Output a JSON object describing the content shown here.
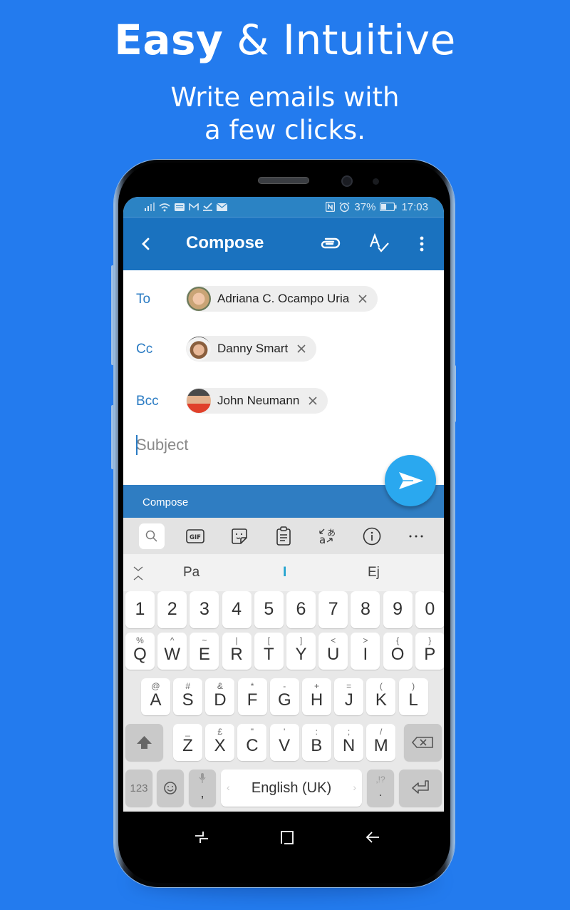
{
  "promo": {
    "headline_bold": "Easy",
    "headline_rest": " & Intuitive",
    "subhead_line1": "Write emails with",
    "subhead_line2": "a few clicks."
  },
  "status_bar": {
    "left_icons": [
      "signal-icon",
      "wifi-icon",
      "keyboard-icon",
      "gmail-icon",
      "check-icon",
      "mail-icon"
    ],
    "right_icons": [
      "nfc-icon",
      "alarm-icon",
      "battery-icon"
    ],
    "battery": "37%",
    "time": "17:03"
  },
  "toolbar": {
    "title": "Compose",
    "back_icon": "chevron-left-icon",
    "actions": [
      "attach-icon",
      "spellcheck-icon",
      "more-vert-icon"
    ]
  },
  "recipients": {
    "to": {
      "label": "To",
      "chips": [
        {
          "name": "Adriana C. Ocampo Uria"
        }
      ]
    },
    "cc": {
      "label": "Cc",
      "chips": [
        {
          "name": "Danny Smart"
        }
      ]
    },
    "bcc": {
      "label": "Bcc",
      "chips": [
        {
          "name": "John Neumann"
        }
      ]
    }
  },
  "subject": {
    "placeholder": "Subject",
    "value": ""
  },
  "compose_strip": {
    "label": "Compose"
  },
  "send_button": {
    "icon": "send-icon"
  },
  "keyboard": {
    "toolbar": [
      "search-icon",
      "gif-icon",
      "sticker-icon",
      "clipboard-icon",
      "translate-icon",
      "info-icon",
      "more-horiz-icon"
    ],
    "suggestions": [
      "Pa",
      "I",
      "Ej"
    ],
    "row_numbers": [
      "1",
      "2",
      "3",
      "4",
      "5",
      "6",
      "7",
      "8",
      "9",
      "0"
    ],
    "row1": [
      {
        "main": "Q",
        "alt": "%"
      },
      {
        "main": "W",
        "alt": "^"
      },
      {
        "main": "E",
        "alt": "~"
      },
      {
        "main": "R",
        "alt": "|"
      },
      {
        "main": "T",
        "alt": "["
      },
      {
        "main": "Y",
        "alt": "]"
      },
      {
        "main": "U",
        "alt": "<"
      },
      {
        "main": "I",
        "alt": ">"
      },
      {
        "main": "O",
        "alt": "{"
      },
      {
        "main": "P",
        "alt": "}"
      }
    ],
    "row2": [
      {
        "main": "A",
        "alt": "@"
      },
      {
        "main": "S",
        "alt": "#"
      },
      {
        "main": "D",
        "alt": "&"
      },
      {
        "main": "F",
        "alt": "*"
      },
      {
        "main": "G",
        "alt": "-"
      },
      {
        "main": "H",
        "alt": "+"
      },
      {
        "main": "J",
        "alt": "="
      },
      {
        "main": "K",
        "alt": "("
      },
      {
        "main": "L",
        "alt": ")"
      }
    ],
    "row3": [
      {
        "main": "Z",
        "alt": "_"
      },
      {
        "main": "X",
        "alt": "£"
      },
      {
        "main": "C",
        "alt": "\""
      },
      {
        "main": "V",
        "alt": "'"
      },
      {
        "main": "B",
        "alt": ":"
      },
      {
        "main": "N",
        "alt": ";"
      },
      {
        "main": "M",
        "alt": "/"
      }
    ],
    "bottom": {
      "numbers_key": "123",
      "comma_key": ",",
      "space_label": "English (UK)",
      "period_key": ".",
      "period_alt": ",!?"
    }
  },
  "nav_bar": {
    "buttons": [
      "recents-icon",
      "home-icon",
      "back-icon"
    ]
  },
  "colors": {
    "background": "#237bee",
    "app_bar": "#1a72bf",
    "status_bar": "#2b83c4",
    "accent": "#2a7bc3",
    "fab": "#2aa8ef"
  }
}
